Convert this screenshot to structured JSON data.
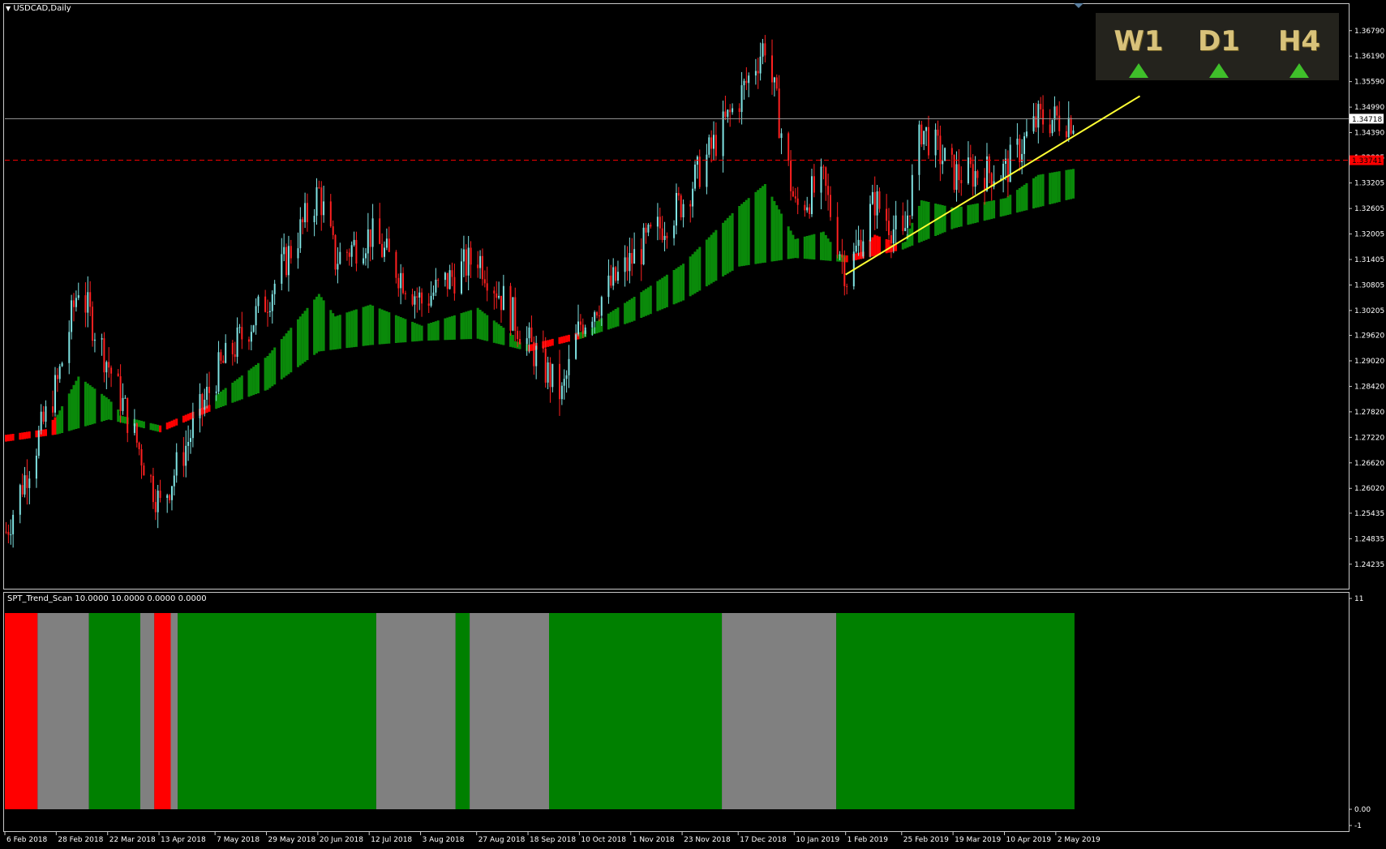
{
  "symbol_label": "USDCAD,Daily",
  "indicator_label": "SPT_Trend_Scan 10.0000 10.0000 0.0000 0.0000",
  "timeframe_panel": [
    {
      "label": "W1",
      "direction": "up",
      "color": "#3fbf2a"
    },
    {
      "label": "D1",
      "direction": "up",
      "color": "#3fbf2a"
    },
    {
      "label": "H4",
      "direction": "up",
      "color": "#3fbf2a"
    }
  ],
  "colors": {
    "background": "#000000",
    "bull_candle": "#7fe3e3",
    "bear_candle": "#ff2020",
    "cloud_up": "#0a8a0a",
    "cloud_down": "#ff0000",
    "trendline": "#ffff33",
    "level_line": "#ff0000",
    "bar_green": "#008000",
    "bar_gray": "#808080",
    "bar_red": "#ff0000"
  },
  "chart_data": [
    {
      "type": "candlestick",
      "title": "USDCAD,Daily",
      "ylim": [
        1.2425,
        1.369
      ],
      "y_ticks": [
        "1.36790",
        "1.36190",
        "1.35590",
        "1.34990",
        "1.34390",
        "1.33805",
        "1.33205",
        "1.32605",
        "1.32005",
        "1.31405",
        "1.30805",
        "1.30205",
        "1.29620",
        "1.29020",
        "1.28420",
        "1.27820",
        "1.27220",
        "1.26620",
        "1.26020",
        "1.25435",
        "1.24835",
        "1.24235"
      ],
      "x_ticks": [
        "6 Feb 2018",
        "28 Feb 2018",
        "22 Mar 2018",
        "13 Apr 2018",
        "7 May 2018",
        "29 May 2018",
        "20 Jun 2018",
        "12 Jul 2018",
        "3 Aug 2018",
        "27 Aug 2018",
        "18 Sep 2018",
        "10 Oct 2018",
        "1 Nov 2018",
        "23 Nov 2018",
        "17 Dec 2018",
        "10 Jan 2019",
        "1 Feb 2019",
        "25 Feb 2019",
        "19 Mar 2019",
        "10 Apr 2019",
        "2 May 2019"
      ],
      "current_price": "1.34718",
      "level_price": "1.33741",
      "close_path": [
        {
          "date": "6 Feb 2018",
          "close": 1.25
        },
        {
          "date": "28 Feb 2018",
          "close": 1.285
        },
        {
          "date": "9 Mar 2018",
          "close": 1.308
        },
        {
          "date": "22 Mar 2018",
          "close": 1.289
        },
        {
          "date": "13 Apr 2018",
          "close": 1.256
        },
        {
          "date": "7 May 2018",
          "close": 1.287
        },
        {
          "date": "29 May 2018",
          "close": 1.305
        },
        {
          "date": "20 Jun 2018",
          "close": 1.33
        },
        {
          "date": "27 Jun 2018",
          "close": 1.314
        },
        {
          "date": "12 Jul 2018",
          "close": 1.32
        },
        {
          "date": "3 Aug 2018",
          "close": 1.304
        },
        {
          "date": "27 Aug 2018",
          "close": 1.315
        },
        {
          "date": "18 Sep 2018",
          "close": 1.294
        },
        {
          "date": "2 Oct 2018",
          "close": 1.282
        },
        {
          "date": "10 Oct 2018",
          "close": 1.299
        },
        {
          "date": "1 Nov 2018",
          "close": 1.314
        },
        {
          "date": "23 Nov 2018",
          "close": 1.328
        },
        {
          "date": "17 Dec 2018",
          "close": 1.352
        },
        {
          "date": "28 Dec 2018",
          "close": 1.365
        },
        {
          "date": "10 Jan 2019",
          "close": 1.326
        },
        {
          "date": "22 Jan 2019",
          "close": 1.332
        },
        {
          "date": "1 Feb 2019",
          "close": 1.31
        },
        {
          "date": "13 Feb 2019",
          "close": 1.328
        },
        {
          "date": "25 Feb 2019",
          "close": 1.318
        },
        {
          "date": "5 Mar 2019",
          "close": 1.345
        },
        {
          "date": "19 Mar 2019",
          "close": 1.334
        },
        {
          "date": "10 Apr 2019",
          "close": 1.335
        },
        {
          "date": "24 Apr 2019",
          "close": 1.347
        },
        {
          "date": "9 May 2019",
          "close": 1.3472
        }
      ],
      "cloud_path": [
        {
          "date": "6 Feb 2018",
          "mid": 1.2718,
          "trend": "down"
        },
        {
          "date": "28 Feb 2018",
          "mid": 1.2735,
          "trend": "up"
        },
        {
          "date": "22 Mar 2018",
          "mid": 1.277,
          "trend": "up"
        },
        {
          "date": "13 Apr 2018",
          "mid": 1.274,
          "trend": "down"
        },
        {
          "date": "7 May 2018",
          "mid": 1.2795,
          "trend": "up"
        },
        {
          "date": "29 May 2018",
          "mid": 1.284,
          "trend": "up"
        },
        {
          "date": "20 Jun 2018",
          "mid": 1.293,
          "trend": "up"
        },
        {
          "date": "12 Jul 2018",
          "mid": 1.2945,
          "trend": "up"
        },
        {
          "date": "3 Aug 2018",
          "mid": 1.2955,
          "trend": "up"
        },
        {
          "date": "27 Aug 2018",
          "mid": 1.296,
          "trend": "up"
        },
        {
          "date": "18 Sep 2018",
          "mid": 1.293,
          "trend": "down"
        },
        {
          "date": "10 Oct 2018",
          "mid": 1.296,
          "trend": "up"
        },
        {
          "date": "1 Nov 2018",
          "mid": 1.3,
          "trend": "up"
        },
        {
          "date": "23 Nov 2018",
          "mid": 1.305,
          "trend": "up"
        },
        {
          "date": "17 Dec 2018",
          "mid": 1.313,
          "trend": "up"
        },
        {
          "date": "10 Jan 2019",
          "mid": 1.315,
          "trend": "up"
        },
        {
          "date": "1 Feb 2019",
          "mid": 1.314,
          "trend": "down"
        },
        {
          "date": "25 Feb 2019",
          "mid": 1.317,
          "trend": "up"
        },
        {
          "date": "19 Mar 2019",
          "mid": 1.322,
          "trend": "up"
        },
        {
          "date": "10 Apr 2019",
          "mid": 1.325,
          "trend": "up"
        },
        {
          "date": "9 May 2019",
          "mid": 1.329,
          "trend": "up"
        }
      ],
      "trendline": {
        "from": {
          "date": "1 Feb 2019",
          "price": 1.3105
        },
        "to": {
          "date": "7 Jun 2019",
          "price": 1.3525
        }
      }
    },
    {
      "type": "bar",
      "title": "SPT_Trend_Scan 10.0000 10.0000 0.0000 0.0000",
      "y_ticks": [
        "11",
        "0.00",
        "-1"
      ],
      "segments": [
        {
          "from": "6 Feb 2018",
          "to": "20 Feb 2018",
          "state": "red"
        },
        {
          "from": "20 Feb 2018",
          "to": "14 Mar 2018",
          "state": "gray"
        },
        {
          "from": "14 Mar 2018",
          "to": "5 Apr 2018",
          "state": "green"
        },
        {
          "from": "5 Apr 2018",
          "to": "11 Apr 2018",
          "state": "gray"
        },
        {
          "from": "11 Apr 2018",
          "to": "18 Apr 2018",
          "state": "red"
        },
        {
          "from": "18 Apr 2018",
          "to": "21 Apr 2018",
          "state": "gray"
        },
        {
          "from": "21 Apr 2018",
          "to": "15 Jul 2018",
          "state": "green"
        },
        {
          "from": "15 Jul 2018",
          "to": "18 Aug 2018",
          "state": "gray"
        },
        {
          "from": "18 Aug 2018",
          "to": "24 Aug 2018",
          "state": "green"
        },
        {
          "from": "24 Aug 2018",
          "to": "27 Sep 2018",
          "state": "gray"
        },
        {
          "from": "27 Sep 2018",
          "to": "10 Dec 2018",
          "state": "green"
        },
        {
          "from": "10 Dec 2018",
          "to": "28 Jan 2019",
          "state": "gray"
        },
        {
          "from": "28 Jan 2019",
          "to": "10 May 2019",
          "state": "green"
        }
      ]
    }
  ]
}
